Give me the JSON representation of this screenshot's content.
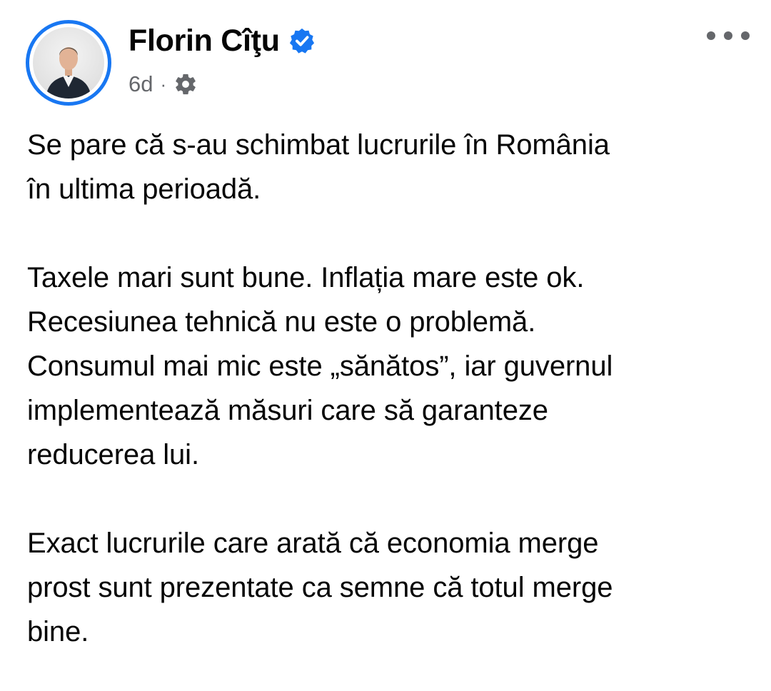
{
  "post": {
    "author": {
      "name": "Florin Cîţu",
      "verified": true,
      "avatar": "profile-photo-man-in-suit"
    },
    "timestamp": "6d",
    "separator": "·",
    "audience_icon": "gear-icon",
    "more_icon": "ellipsis-icon",
    "paragraphs": [
      [
        "Se pare că s-au schimbat lucrurile în România",
        "în ultima perioadă."
      ],
      [
        "Taxele mari sunt bune. Inflația mare este ok.",
        "Recesiunea tehnică nu este o problemă.",
        "Consumul mai mic este „sănătos”, iar guvernul",
        "implementează măsuri care să garanteze",
        "reducerea lui."
      ],
      [
        "Exact lucrurile care arată că economia merge",
        "prost sunt prezentate ca semne că totul merge",
        "bine."
      ]
    ]
  },
  "colors": {
    "accent": "#1877f2",
    "text": "#050505",
    "secondary": "#65676b"
  }
}
